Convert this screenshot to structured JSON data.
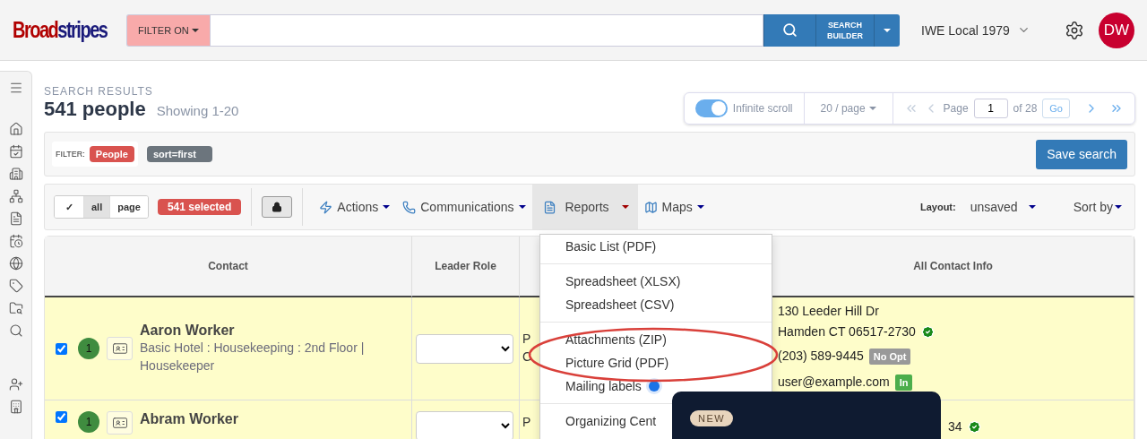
{
  "header": {
    "logo": {
      "part_1": "Broad",
      "part_2": "stripes"
    },
    "filter_button": "FILTER ON",
    "search_builder": {
      "line_1": "SEARCH",
      "line_2": "BUILDER"
    },
    "organization": "IWE Local 1979",
    "avatar": "DW"
  },
  "results": {
    "label": "SEARCH RESULTS",
    "title": "541 people",
    "subtitle": "Showing 1-20"
  },
  "pager": {
    "infinite_scroll": {
      "label": "Infinite scroll",
      "on": true
    },
    "per_page": "20 / page",
    "page_label": "Page",
    "page": "1",
    "page_count": "of 28",
    "go": "Go"
  },
  "filter_bar": {
    "label": "FILTER:",
    "tags": [
      {
        "text": "People",
        "color": "#d9534f"
      },
      {
        "text": "sort=first",
        "color": "#6c757d"
      }
    ],
    "save": "Save search"
  },
  "toolbar": {
    "select_options": [
      {
        "label": "✓",
        "selected": false
      },
      {
        "label": "all",
        "selected": true
      },
      {
        "label": "page",
        "selected": false
      }
    ],
    "selected_count": "541 selected",
    "menus": [
      {
        "kind": "actions",
        "label": "Actions",
        "open": false
      },
      {
        "kind": "communications",
        "label": "Communications",
        "open": false
      },
      {
        "kind": "reports",
        "label": "Reports",
        "open": true
      },
      {
        "kind": "maps",
        "label": "Maps",
        "open": false
      }
    ],
    "layout_label": "Layout:",
    "layout_value": "unsaved",
    "sort": "Sort by"
  },
  "reports_menu": [
    [
      "Basic List (PDF)"
    ],
    [
      "Spreadsheet (XLSX)",
      "Spreadsheet (CSV)"
    ],
    [
      "Attachments (ZIP)",
      "Picture Grid (PDF)",
      {
        "label": "Mailing labels",
        "new": true
      }
    ],
    [
      "Organizing Cent"
    ]
  ],
  "table": {
    "columns": [
      "Contact",
      "Leader Role",
      "All Contact Info"
    ],
    "rows": [
      {
        "checked": true,
        "badge": "1",
        "name": "Aaron Worker",
        "detail": "Basic Hotel : Housekeeping : 2nd Floor | Housekeeper",
        "column_3": [
          "P",
          "C"
        ],
        "address": [
          "130 Leeder Hill Dr",
          "Hamden CT 06517-2730"
        ],
        "verified": true,
        "phone": "(203) 589-9445",
        "phone_tag": "No Opt",
        "email": "user@example.com",
        "email_tag": "In"
      },
      {
        "checked": true,
        "badge": "1",
        "name": "Abram Worker",
        "column_3": [
          "P"
        ],
        "address": [
          "34"
        ],
        "verified": true
      }
    ]
  },
  "popup": {
    "badge": "NEW"
  }
}
